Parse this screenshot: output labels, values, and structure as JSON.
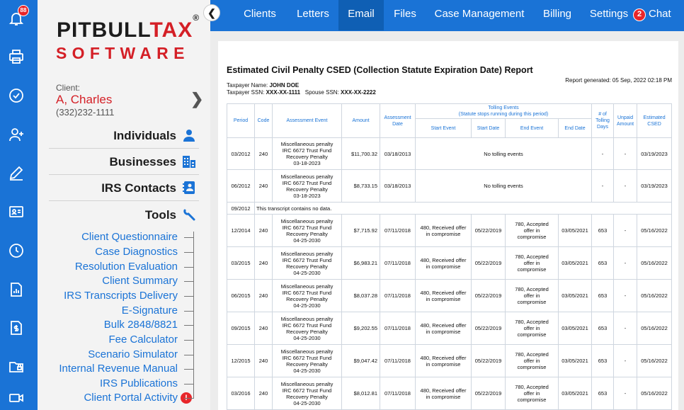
{
  "rail": {
    "notification_count": "88"
  },
  "logo": {
    "line1_black": "PITBULL",
    "line1_red": "TAX",
    "registered": "®",
    "line2": "SOFTWARE"
  },
  "client": {
    "label": "Client:",
    "name": "A, Charles",
    "phone": "(332)232-1111"
  },
  "sections": [
    {
      "label": "Individuals",
      "icon": "person-icon"
    },
    {
      "label": "Businesses",
      "icon": "buildings-icon"
    },
    {
      "label": "IRS Contacts",
      "icon": "contacts-icon"
    },
    {
      "label": "Tools",
      "icon": "wrench-icon"
    }
  ],
  "tools": [
    "Client Questionnaire",
    "Case Diagnostics",
    "Resolution Evaluation",
    "Client Summary",
    "IRS Transcripts Delivery",
    "E-Signature",
    "Bulk 2848/8821",
    "Fee Calculator",
    "Scenario Simulator",
    "Internal Revenue Manual",
    "IRS Publications",
    "Client Portal Activity"
  ],
  "tools_alert": "!",
  "nav": {
    "items": [
      "Clients",
      "Letters",
      "Email",
      "Files",
      "Case Management",
      "Billing",
      "Settings"
    ],
    "active": "Email",
    "chat_count": "2",
    "chat_label": "Chat"
  },
  "report": {
    "title": "Estimated Civil Penalty CSED (Collection Statute Expiration Date) Report",
    "generated": "Report generated: 05 Sep, 2022 02:18 PM",
    "taxpayer_name_label": "Taxpayer Name:",
    "taxpayer_name": "JOHN DOE",
    "taxpayer_ssn_label": "Taxpayer SSN:",
    "taxpayer_ssn": "XXX-XX-1111",
    "spouse_ssn_label": "Spouse SSN:",
    "spouse_ssn": "XXX-XX-2222",
    "headers": {
      "period": "Period",
      "code": "Code",
      "assessment_event": "Assessment Event",
      "amount": "Amount",
      "assessment_date": "Assessment Date",
      "tolling_events": "Tolling Events",
      "tolling_note": "(Statute stops running during this period)",
      "start_event": "Start Event",
      "start_date": "Start Date",
      "end_event": "End Event",
      "end_date": "End Date",
      "tolling_days": "# of Tolling Days",
      "unpaid_amount": "Unpaid Amount",
      "estimated_csed": "Estimated CSED"
    },
    "rows": [
      {
        "period": "03/2012",
        "code": "240",
        "event": [
          "Miscellaneous penalty",
          "IRC 6672 Trust Fund",
          "Recovery Penalty",
          "03-18-2023"
        ],
        "amount": "$11,700.32",
        "assess_date": "03/18/2013",
        "tolling": "No tolling events",
        "days": "-",
        "unpaid": "-",
        "csed": "03/19/2023"
      },
      {
        "period": "06/2012",
        "code": "240",
        "event": [
          "Miscellaneous penalty",
          "IRC 6672 Trust Fund",
          "Recovery Penalty",
          "03-18-2023"
        ],
        "amount": "$8,733.15",
        "assess_date": "03/18/2013",
        "tolling": "No tolling events",
        "days": "-",
        "unpaid": "-",
        "csed": "03/19/2023"
      },
      {
        "period": "09/2012",
        "note": "This transcript contains no data."
      },
      {
        "period": "12/2014",
        "code": "240",
        "event": [
          "Miscellaneous penalty",
          "IRC 6672 Trust Fund",
          "Recovery Penalty",
          "04-25-2030"
        ],
        "amount": "$7,715.92",
        "assess_date": "07/11/2018",
        "start_event": [
          "480, Received offer",
          "in compromise"
        ],
        "start_date": "05/22/2019",
        "end_event": [
          "780, Accepted",
          "offer in",
          "compromise"
        ],
        "end_date": "03/05/2021",
        "days": "653",
        "unpaid": "-",
        "csed": "05/16/2022"
      },
      {
        "period": "03/2015",
        "code": "240",
        "event": [
          "Miscellaneous penalty",
          "IRC 6672 Trust Fund",
          "Recovery Penalty",
          "04-25-2030"
        ],
        "amount": "$6,983.21",
        "assess_date": "07/11/2018",
        "start_event": [
          "480, Received offer",
          "in compromise"
        ],
        "start_date": "05/22/2019",
        "end_event": [
          "780, Accepted",
          "offer in",
          "compromise"
        ],
        "end_date": "03/05/2021",
        "days": "653",
        "unpaid": "-",
        "csed": "05/16/2022"
      },
      {
        "period": "06/2015",
        "code": "240",
        "event": [
          "Miscellaneous penalty",
          "IRC 6672 Trust Fund",
          "Recovery Penalty",
          "04-25-2030"
        ],
        "amount": "$8,037.28",
        "assess_date": "07/11/2018",
        "start_event": [
          "480, Received offer",
          "in compromise"
        ],
        "start_date": "05/22/2019",
        "end_event": [
          "780, Accepted",
          "offer in",
          "compromise"
        ],
        "end_date": "03/05/2021",
        "days": "653",
        "unpaid": "-",
        "csed": "05/16/2022"
      },
      {
        "period": "09/2015",
        "code": "240",
        "event": [
          "Miscellaneous penalty",
          "IRC 6672 Trust Fund",
          "Recovery Penalty",
          "04-25-2030"
        ],
        "amount": "$9,202.55",
        "assess_date": "07/11/2018",
        "start_event": [
          "480, Received offer",
          "in compromise"
        ],
        "start_date": "05/22/2019",
        "end_event": [
          "780, Accepted",
          "offer in",
          "compromise"
        ],
        "end_date": "03/05/2021",
        "days": "653",
        "unpaid": "-",
        "csed": "05/16/2022"
      },
      {
        "period": "12/2015",
        "code": "240",
        "event": [
          "Miscellaneous penalty",
          "IRC 6672 Trust Fund",
          "Recovery Penalty",
          "04-25-2030"
        ],
        "amount": "$9,047.42",
        "assess_date": "07/11/2018",
        "start_event": [
          "480, Received offer",
          "in compromise"
        ],
        "start_date": "05/22/2019",
        "end_event": [
          "780, Accepted",
          "offer in",
          "compromise"
        ],
        "end_date": "03/05/2021",
        "days": "653",
        "unpaid": "-",
        "csed": "05/16/2022"
      },
      {
        "period": "03/2016",
        "code": "240",
        "event": [
          "Miscellaneous penalty",
          "IRC 6672 Trust Fund",
          "Recovery Penalty",
          "04-25-2030"
        ],
        "amount": "$8,012.81",
        "assess_date": "07/11/2018",
        "start_event": [
          "480, Received offer",
          "in compromise"
        ],
        "start_date": "05/22/2019",
        "end_event": [
          "780, Accepted",
          "offer in",
          "compromise"
        ],
        "end_date": "03/05/2021",
        "days": "653",
        "unpaid": "-",
        "csed": "05/16/2022"
      }
    ]
  }
}
